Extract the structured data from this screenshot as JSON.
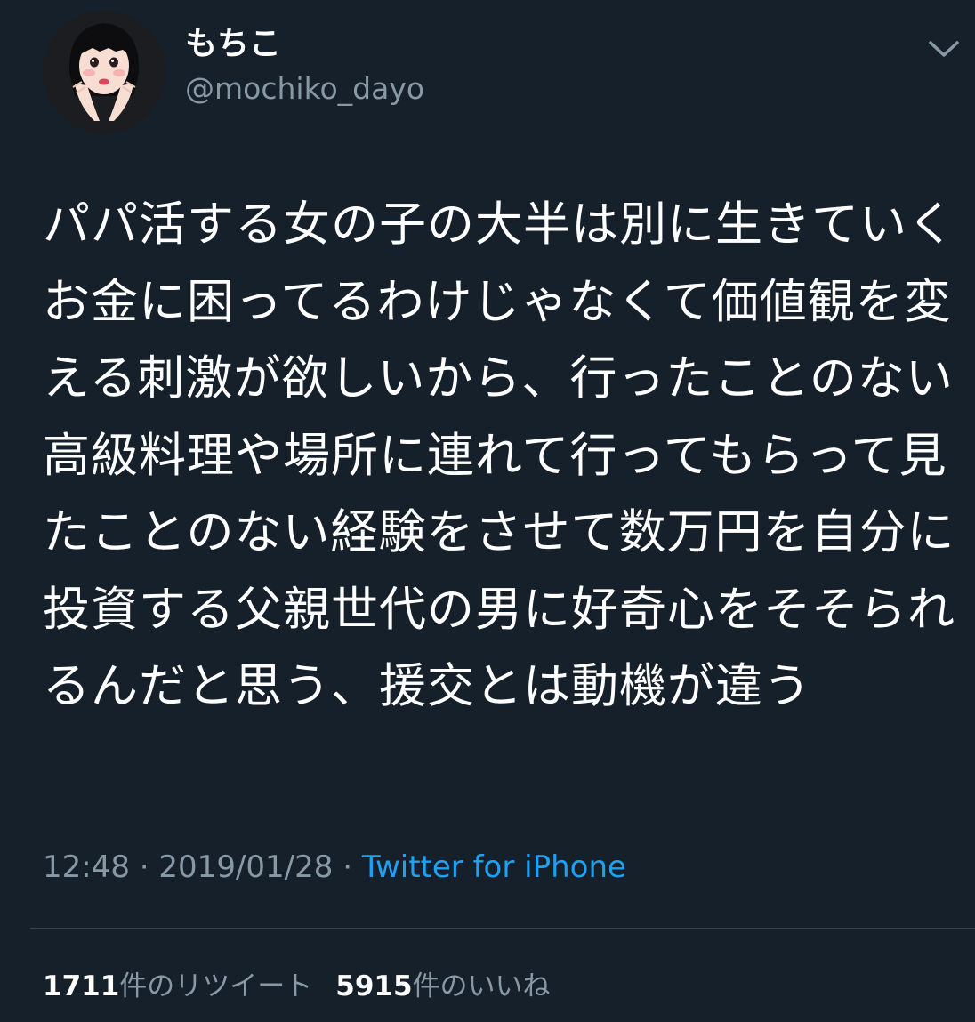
{
  "colors": {
    "background": "#15202b",
    "primary_text": "#ffffff",
    "secondary_text": "#8899a6",
    "link": "#1da1f2",
    "divider": "#38444d"
  },
  "author": {
    "avatar_icon": "illustrated-girl-avatar-icon",
    "display_name": "もちこ",
    "handle": "@mochiko_dayo"
  },
  "menu_icon": "chevron-down-icon",
  "tweet": {
    "text": "パパ活する女の子の大半は別に生きていくお金に困ってるわけじゃなくて価値観を変える刺激が欲しいから、行ったことのない高級料理や場所に連れて行ってもらって見たことのない経験をさせて数万円を自分に投資する父親世代の男に好奇心をそそられるんだと思う、援交とは動機が違う",
    "time": "12:48",
    "separator": " · ",
    "date": "2019/01/28",
    "source": "Twitter for iPhone"
  },
  "stats": {
    "retweets_count": "1711",
    "retweets_label": "件のリツイート",
    "likes_count": "5915",
    "likes_label": "件のいいね"
  }
}
